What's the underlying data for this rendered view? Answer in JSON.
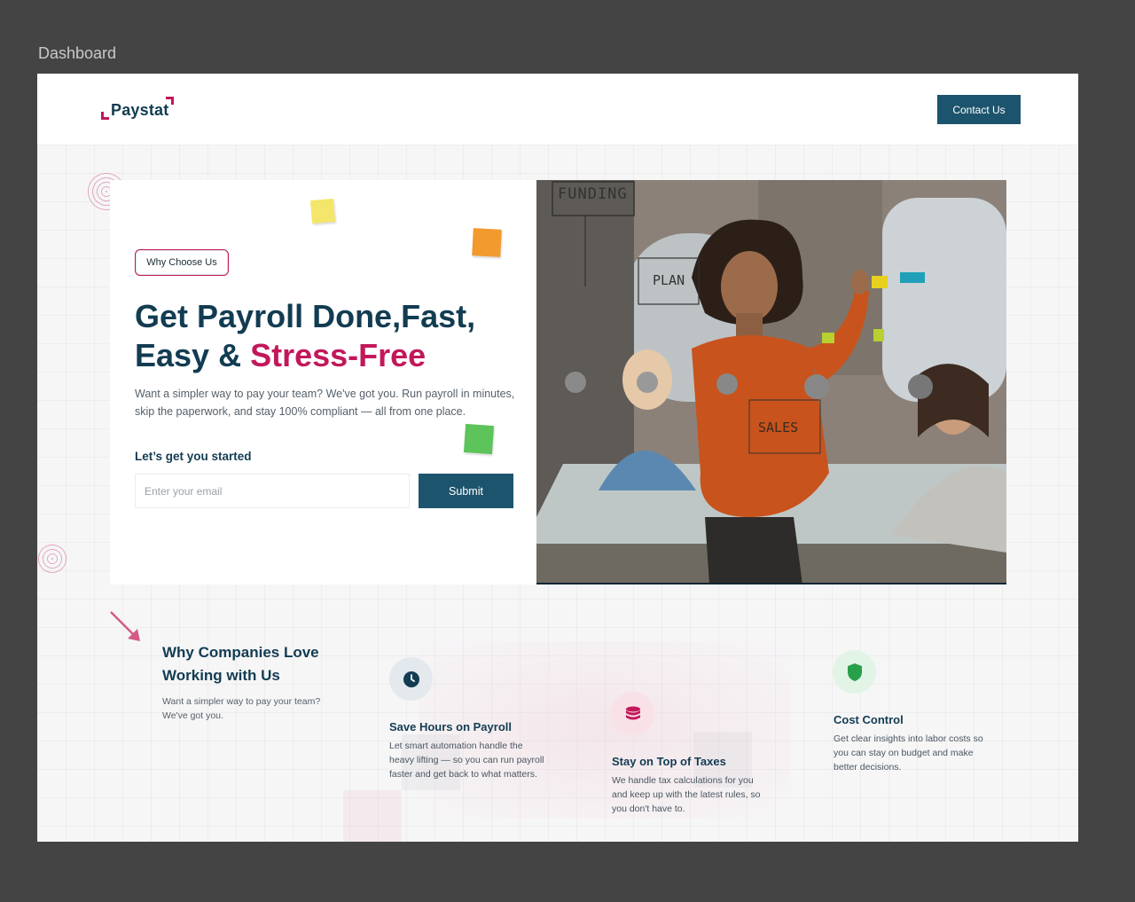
{
  "frame": {
    "label": "Dashboard"
  },
  "header": {
    "logo_text": "Paystat",
    "contact_label": "Contact Us"
  },
  "hero": {
    "badge": "Why Choose Us",
    "title_line1": "Get Payroll Done,Fast,",
    "title_line2_prefix": "Easy & ",
    "title_line2_accent": "Stress-Free",
    "subtitle": "Want a simpler way to pay your team? We've got you. Run payroll in minutes, skip the paperwork, and stay 100% compliant — all from one place.",
    "cta_heading": "Let’s get you started",
    "email_placeholder": "Enter your email",
    "submit_label": "Submit"
  },
  "photo": {
    "whiteboard_words": [
      "FUNDING",
      "PLAN",
      "SALES"
    ]
  },
  "features": {
    "section_title": "Why Companies Love Working with Us",
    "section_subtitle": "Want a simpler way to pay your team? We've got you.",
    "items": [
      {
        "icon": "clock-icon",
        "title": "Save Hours on Payroll",
        "description": "Let smart automation handle the heavy lifting — so you can run payroll faster and get back to what matters."
      },
      {
        "icon": "coins-stack-icon",
        "title": "Stay on Top of Taxes",
        "description": "We handle tax calculations for you and keep up with the latest rules, so you don't have to."
      },
      {
        "icon": "shield-icon",
        "title": "Cost Control",
        "description": "Get clear insights into labor costs so you can stay on budget and make better decisions."
      }
    ]
  },
  "colors": {
    "primary": "#123c52",
    "button": "#1d546d",
    "accent": "#c2185b",
    "frame_bg": "#444444"
  }
}
